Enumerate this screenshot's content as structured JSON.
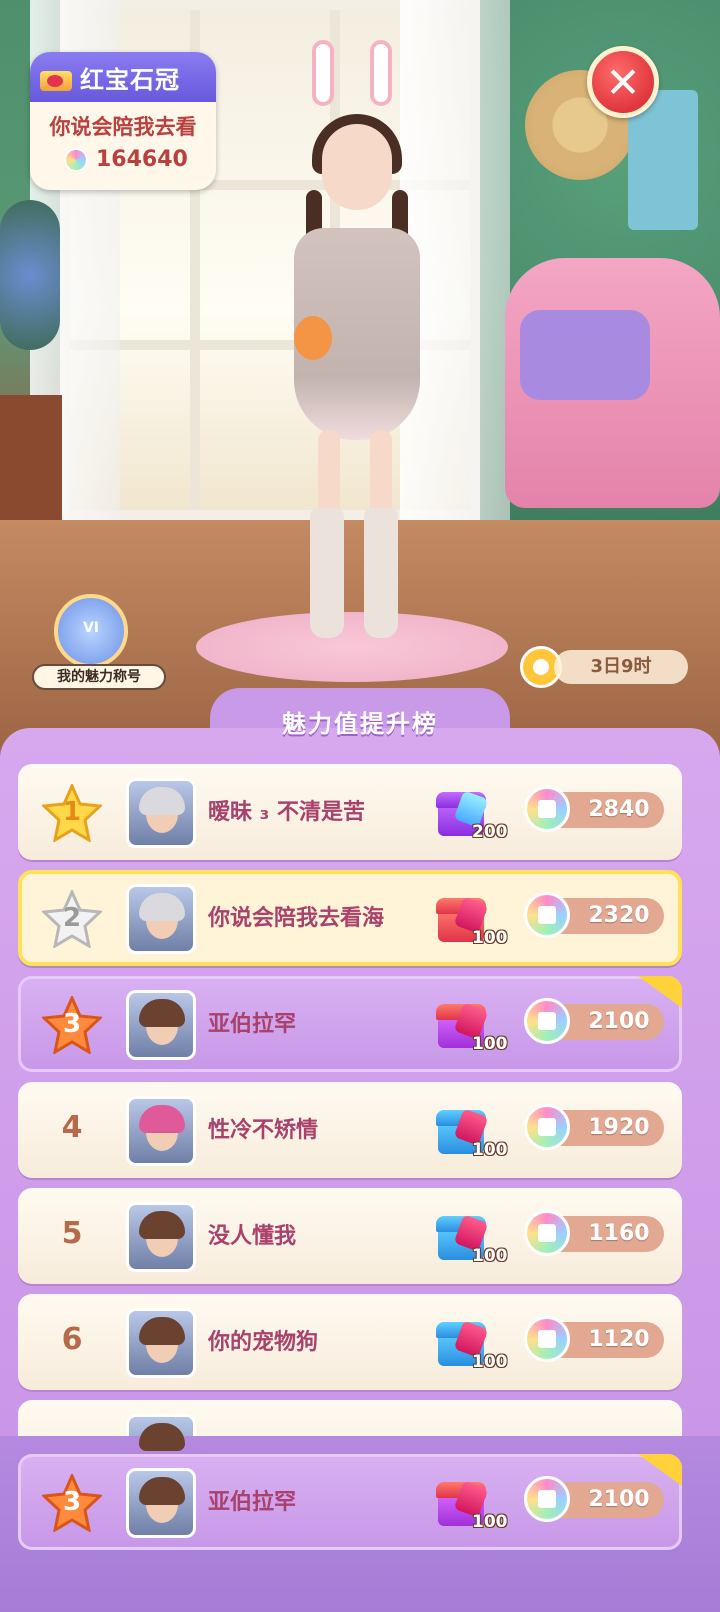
{
  "header": {
    "rank_title": "红宝石冠",
    "player_name": "你说会陪我去看",
    "score": "164640"
  },
  "charm_badge": {
    "label": "我的魅力称号"
  },
  "countdown": {
    "text": "3日9时"
  },
  "panel": {
    "title": "魅力值提升榜"
  },
  "leaderboard": [
    {
      "rank": "1",
      "name": "暧昧 ₃ 不清是苦",
      "chest_qty": "200",
      "score": "2840"
    },
    {
      "rank": "2",
      "name": "你说会陪我去看海",
      "chest_qty": "100",
      "score": "2320"
    },
    {
      "rank": "3",
      "name": "亚伯拉罕",
      "chest_qty": "100",
      "score": "2100"
    },
    {
      "rank": "4",
      "name": "性冷不矫情",
      "chest_qty": "100",
      "score": "1920"
    },
    {
      "rank": "5",
      "name": "没人懂我",
      "chest_qty": "100",
      "score": "1160"
    },
    {
      "rank": "6",
      "name": "你的宠物狗",
      "chest_qty": "100",
      "score": "1120"
    }
  ],
  "self_row": {
    "rank": "3",
    "name": "亚伯拉罕",
    "chest_qty": "100",
    "score": "2100"
  },
  "colors": {
    "panel_purple": "#c792e6",
    "name_pink": "#a8416b",
    "gold": "#ffd23c"
  }
}
